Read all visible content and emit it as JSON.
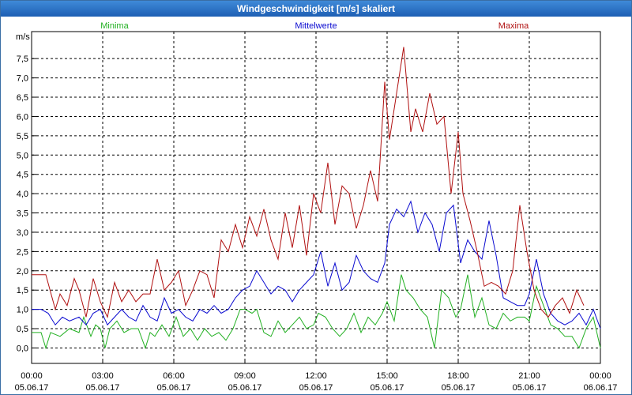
{
  "window": {
    "title": "Windgeschwindigkeit [m/s] skaliert"
  },
  "chart_data": {
    "type": "line",
    "title": "Windgeschwindigkeit [m/s] skaliert",
    "ylabel": "m/s",
    "ylim": [
      -0.4,
      8.2
    ],
    "xlim": [
      "05.06.17 00:00",
      "06.06.17 00:00"
    ],
    "grid": true,
    "legend_placement": "top",
    "y_ticks": [
      "0,0",
      "0,5",
      "1,0",
      "1,5",
      "2,0",
      "2,5",
      "3,0",
      "3,5",
      "4,0",
      "4,5",
      "5,0",
      "5,5",
      "6,0",
      "6,5",
      "7,0",
      "7,5"
    ],
    "y_tick_values": [
      0,
      0.5,
      1,
      1.5,
      2,
      2.5,
      3,
      3.5,
      4,
      4.5,
      5,
      5.5,
      6,
      6.5,
      7,
      7.5
    ],
    "x_ticks": [
      {
        "time": "00:00",
        "date": "05.06.17"
      },
      {
        "time": "03:00",
        "date": "05.06.17"
      },
      {
        "time": "06:00",
        "date": "05.06.17"
      },
      {
        "time": "09:00",
        "date": "05.06.17"
      },
      {
        "time": "12:00",
        "date": "05.06.17"
      },
      {
        "time": "15:00",
        "date": "05.06.17"
      },
      {
        "time": "18:00",
        "date": "05.06.17"
      },
      {
        "time": "21:00",
        "date": "05.06.17"
      },
      {
        "time": "00:00",
        "date": "06.06.17"
      }
    ],
    "x_hours": [
      0,
      3,
      6,
      9,
      12,
      15,
      18,
      21,
      24
    ],
    "series": [
      {
        "name": "Minima",
        "color": "#22b022",
        "hours": [
          0,
          0.4,
          0.6,
          0.8,
          1.2,
          1.6,
          2,
          2.2,
          2.5,
          2.7,
          2.9,
          3.1,
          3.3,
          3.6,
          3.9,
          4.2,
          4.5,
          4.8,
          5,
          5.2,
          5.5,
          5.8,
          6.1,
          6.4,
          6.7,
          7,
          7.3,
          7.6,
          7.9,
          8.2,
          8.5,
          8.8,
          9,
          9.3,
          9.5,
          9.8,
          10.1,
          10.4,
          10.7,
          11,
          11.3,
          11.6,
          11.9,
          12.1,
          12.4,
          12.7,
          13,
          13.3,
          13.6,
          13.9,
          14.2,
          14.5,
          14.8,
          15,
          15.3,
          15.6,
          15.8,
          16.1,
          16.4,
          16.7,
          17,
          17.3,
          17.6,
          17.9,
          18.1,
          18.4,
          18.7,
          19,
          19.3,
          19.6,
          19.9,
          20.2,
          20.5,
          20.8,
          21,
          21.3,
          21.6,
          21.9,
          22.2,
          22.5,
          22.8,
          23.1,
          23.4,
          23.7,
          24
        ],
        "values": [
          0.4,
          0.4,
          0.0,
          0.4,
          0.3,
          0.5,
          0.4,
          0.8,
          0.3,
          0.6,
          0.5,
          0.0,
          0.5,
          0.7,
          0.4,
          0.5,
          0.5,
          0.0,
          0.4,
          0.3,
          0.6,
          0.3,
          0.8,
          0.3,
          0.5,
          0.2,
          0.5,
          0.3,
          0.4,
          0.2,
          0.5,
          1.0,
          1.0,
          0.9,
          1.0,
          0.4,
          0.3,
          0.7,
          0.4,
          0.6,
          0.8,
          0.5,
          0.6,
          0.9,
          0.8,
          0.5,
          0.3,
          0.5,
          0.9,
          0.4,
          0.8,
          0.6,
          0.9,
          1.2,
          0.7,
          1.9,
          1.5,
          1.3,
          1.0,
          0.8,
          0.0,
          1.5,
          1.3,
          0.8,
          1.0,
          1.9,
          0.8,
          1.3,
          0.6,
          0.5,
          0.9,
          0.7,
          0.8,
          0.8,
          0.7,
          1.6,
          1.1,
          0.6,
          0.5,
          0.3,
          0.3,
          0.0,
          0.5,
          0.8,
          0.0
        ]
      },
      {
        "name": "Mittelwerte",
        "color": "#0a0ad0",
        "hours": [
          0,
          0.4,
          0.7,
          1,
          1.3,
          1.6,
          2,
          2.3,
          2.6,
          2.9,
          3.2,
          3.5,
          3.8,
          4.1,
          4.4,
          4.7,
          5,
          5.3,
          5.6,
          5.9,
          6.2,
          6.5,
          6.8,
          7.1,
          7.4,
          7.7,
          8,
          8.3,
          8.6,
          8.9,
          9.2,
          9.5,
          9.8,
          10.1,
          10.4,
          10.7,
          11,
          11.3,
          11.6,
          11.9,
          12.2,
          12.5,
          12.8,
          13.1,
          13.4,
          13.7,
          14,
          14.3,
          14.6,
          14.9,
          15.1,
          15.4,
          15.7,
          16,
          16.3,
          16.6,
          16.9,
          17.2,
          17.5,
          17.8,
          18.1,
          18.4,
          18.7,
          19,
          19.3,
          19.6,
          19.9,
          20.2,
          20.5,
          20.8,
          21,
          21.3,
          21.6,
          21.9,
          22.2,
          22.5,
          22.8,
          23.1,
          23.4,
          23.7,
          24
        ],
        "values": [
          1.0,
          1.0,
          0.9,
          0.6,
          0.8,
          0.7,
          0.8,
          0.6,
          0.9,
          1.0,
          0.6,
          0.8,
          1.0,
          0.8,
          0.7,
          1.1,
          0.8,
          0.7,
          1.3,
          0.9,
          1.0,
          0.8,
          0.7,
          1.0,
          0.9,
          1.1,
          0.9,
          1.0,
          1.3,
          1.5,
          1.6,
          2.0,
          1.7,
          1.4,
          1.6,
          1.5,
          1.2,
          1.5,
          1.7,
          1.9,
          2.5,
          1.6,
          2.2,
          1.5,
          1.7,
          2.4,
          2.0,
          1.8,
          1.7,
          2.2,
          3.2,
          3.6,
          3.4,
          3.8,
          3.0,
          3.5,
          3.2,
          2.5,
          3.5,
          3.7,
          2.2,
          2.8,
          2.5,
          2.3,
          3.3,
          2.4,
          1.3,
          1.2,
          1.1,
          1.1,
          1.4,
          2.3,
          1.4,
          0.9,
          0.7,
          0.6,
          0.7,
          0.9,
          0.6,
          1.0,
          0.5
        ]
      },
      {
        "name": "Maxima",
        "color": "#b01010",
        "hours": [
          0,
          0.4,
          0.6,
          1,
          1.2,
          1.5,
          1.8,
          2,
          2.3,
          2.6,
          2.9,
          3.2,
          3.5,
          3.8,
          4.1,
          4.4,
          4.7,
          5,
          5.3,
          5.6,
          5.9,
          6.2,
          6.5,
          6.8,
          7.1,
          7.4,
          7.7,
          8,
          8.3,
          8.6,
          8.9,
          9.2,
          9.5,
          9.8,
          10.1,
          10.4,
          10.7,
          11,
          11.3,
          11.6,
          11.9,
          12.2,
          12.5,
          12.8,
          13.1,
          13.4,
          13.7,
          14,
          14.3,
          14.6,
          14.9,
          15.1,
          15.4,
          15.7,
          16,
          16.2,
          16.5,
          16.8,
          17.1,
          17.4,
          17.7,
          18,
          18.2,
          18.5,
          18.8,
          19.1,
          19.4,
          19.7,
          20,
          20.3,
          20.6,
          20.9,
          21.2,
          21.5,
          21.8,
          22.1,
          22.4,
          22.7,
          23,
          23.3,
          23.6,
          24
        ],
        "values": [
          1.9,
          1.9,
          1.9,
          1.0,
          1.4,
          1.1,
          1.8,
          1.5,
          0.8,
          1.8,
          1.2,
          0.8,
          1.7,
          1.2,
          1.5,
          1.2,
          1.4,
          1.4,
          2.3,
          1.5,
          1.7,
          2.0,
          1.1,
          1.5,
          2.0,
          1.9,
          1.3,
          2.8,
          2.5,
          3.2,
          2.6,
          3.4,
          2.9,
          3.6,
          2.8,
          2.3,
          3.5,
          2.6,
          3.7,
          2.4,
          4.0,
          3.5,
          4.8,
          3.2,
          4.2,
          4.0,
          3.1,
          3.7,
          4.6,
          3.8,
          6.9,
          5.4,
          6.6,
          7.8,
          5.6,
          6.2,
          5.6,
          6.6,
          5.8,
          6.0,
          4.0,
          5.6,
          4.0,
          3.3,
          2.5,
          1.6,
          1.7,
          1.6,
          1.4,
          2.0,
          3.7,
          2.5,
          1.5,
          1.0,
          0.8,
          1.1,
          1.3,
          0.9,
          1.5,
          1.1
        ]
      }
    ]
  }
}
